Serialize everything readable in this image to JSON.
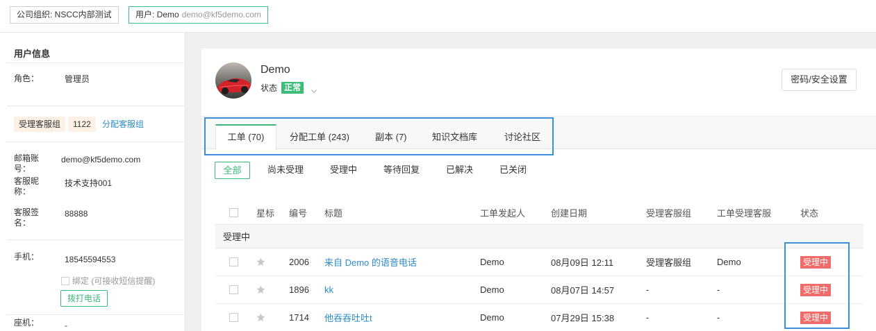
{
  "topbar": {
    "org": "公司组织: NSCC内部测试",
    "user_name": "用户: Demo",
    "user_email": "demo@kf5demo.com"
  },
  "sidebar": {
    "title": "用户信息",
    "role": {
      "label": "角色：",
      "value": "管理员"
    },
    "groups": {
      "tag": "受理客服组",
      "id": "1122",
      "assign_link": "分配客服组"
    },
    "email": {
      "label": "邮箱账号：",
      "value": "demo@kf5demo.com"
    },
    "nickname": {
      "label": "客服昵称：",
      "value": "技术支持001"
    },
    "signature": {
      "label": "客服签名：",
      "value": "88888"
    },
    "mobile": {
      "label": "手机：",
      "value": "18545594553",
      "bind_label": "绑定 (可接收短信提醒)",
      "bind_checked": false,
      "call_button": "拨打电话"
    },
    "landline": {
      "label": "座机：",
      "value": "-"
    }
  },
  "profile": {
    "name": "Demo",
    "status_label": "状态",
    "status_value": "正常",
    "security_button": "密码/安全设置"
  },
  "tabs": [
    {
      "label": "工单 (70)",
      "active": true
    },
    {
      "label": "分配工单 (243)",
      "active": false
    },
    {
      "label": "副本 (7)",
      "active": false
    },
    {
      "label": "知识文档库",
      "active": false
    },
    {
      "label": "讨论社区",
      "active": false
    }
  ],
  "filters": [
    {
      "label": "全部",
      "active": true
    },
    {
      "label": "尚未受理",
      "active": false
    },
    {
      "label": "受理中",
      "active": false
    },
    {
      "label": "等待回复",
      "active": false
    },
    {
      "label": "已解决",
      "active": false
    },
    {
      "label": "已关闭",
      "active": false
    }
  ],
  "table": {
    "columns": [
      "星标",
      "编号",
      "标题",
      "工单发起人",
      "创建日期",
      "受理客服组",
      "工单受理客服",
      "状态"
    ],
    "group_label": "受理中",
    "rows": [
      {
        "id": "2006",
        "title": "来自 Demo 的语音电话",
        "requester": "Demo",
        "created": "08月09日 12:11",
        "group": "受理客服组",
        "agent": "Demo",
        "status": "受理中",
        "starred": false
      },
      {
        "id": "1896",
        "title": "kk",
        "requester": "Demo",
        "created": "08月07日 14:57",
        "group": "-",
        "agent": "-",
        "status": "受理中",
        "starred": false
      },
      {
        "id": "1714",
        "title": "他吞吞吐吐t",
        "requester": "Demo",
        "created": "07月29日 15:38",
        "group": "-",
        "agent": "-",
        "status": "受理中",
        "starred": false
      }
    ]
  },
  "icons": {
    "star": "star-icon",
    "status_dropdown": "chevron-down-icon",
    "checkbox": "checkbox-icon"
  },
  "colors": {
    "accent_green": "#3cb878",
    "link_blue": "#2c8bc6",
    "status_badge_red": "#f26b6b",
    "status_ok_green": "#3cbe79",
    "highlight_blue": "#3d8fdb",
    "tag_peach": "#fdf0e4"
  }
}
